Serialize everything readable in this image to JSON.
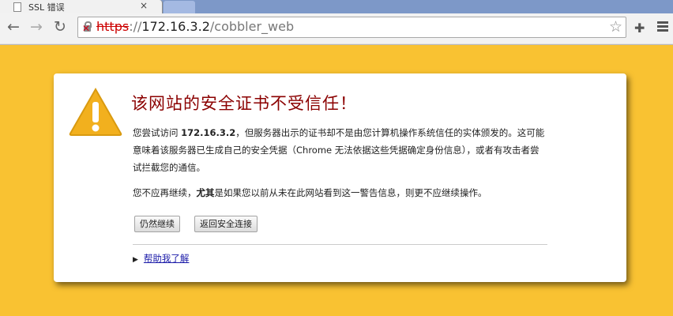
{
  "tab": {
    "title": "SSL 错误",
    "close": "×"
  },
  "toolbar": {
    "back": "←",
    "forward": "→",
    "reload": "↻"
  },
  "omnibox": {
    "scheme": "https",
    "sep": "://",
    "host": "172.16.3.2",
    "path": "/cobbler_web",
    "star": "☆"
  },
  "extensions": {
    "puzzle": "✚"
  },
  "interstitial": {
    "headline": "该网站的安全证书不受信任！",
    "p1_pre": "您尝试访问 ",
    "p1_host": "172.16.3.2",
    "p1_post": "，但服务器出示的证书却不是由您计算机操作系统信任的实体颁发的。这可能意味着该服务器已生成自己的安全凭据（Chrome 无法依据这些凭据确定身份信息），或者有攻击者尝试拦截您的通信。",
    "p2_pre": "您不应再继续，",
    "p2_bold": "尤其",
    "p2_post": "是如果您以前从未在此网站看到这一警告信息，则更不应继续操作。",
    "proceed_label": "仍然继续",
    "back_label": "返回安全连接",
    "more_label": "帮助我了解"
  },
  "colors": {
    "page_bg": "#f9c232",
    "headline": "#8b0000",
    "warning_icon": "#f2b01e",
    "link": "#1a1aa8"
  }
}
